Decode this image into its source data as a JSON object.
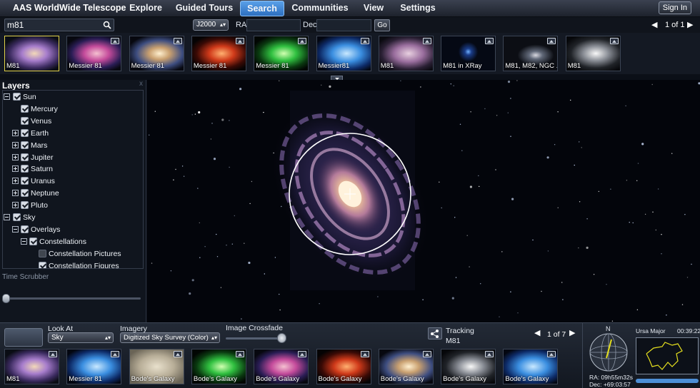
{
  "app": {
    "title": "AAS WorldWide Telescope",
    "sign_in": "Sign In"
  },
  "menu": {
    "items": [
      "Explore",
      "Guided Tours",
      "Search",
      "Communities",
      "View",
      "Settings"
    ],
    "active": "Search"
  },
  "search": {
    "query": "m81",
    "epoch": "J2000",
    "ra_label": "RA",
    "dec_label": "Dec",
    "go_label": "Go",
    "page": "1 of 1"
  },
  "results": [
    {
      "caption": "M81",
      "selected": true
    },
    {
      "caption": "Messier 81"
    },
    {
      "caption": "Messier 81"
    },
    {
      "caption": "Messier 81"
    },
    {
      "caption": "Messier 81"
    },
    {
      "caption": "Messier81"
    },
    {
      "caption": "M81"
    },
    {
      "caption": "M81 in XRay"
    },
    {
      "caption": "M81, M82, NGC ..."
    },
    {
      "caption": "M81"
    }
  ],
  "layers": {
    "title": "Layers",
    "close": "x",
    "tree": [
      {
        "label": "Sun",
        "expander": "minus",
        "checked": true,
        "indent": 0
      },
      {
        "label": "Mercury",
        "expander": "none",
        "checked": true,
        "indent": 1
      },
      {
        "label": "Venus",
        "expander": "none",
        "checked": true,
        "indent": 1
      },
      {
        "label": "Earth",
        "expander": "plus",
        "checked": true,
        "indent": 1
      },
      {
        "label": "Mars",
        "expander": "plus",
        "checked": true,
        "indent": 1
      },
      {
        "label": "Jupiter",
        "expander": "plus",
        "checked": true,
        "indent": 1
      },
      {
        "label": "Saturn",
        "expander": "plus",
        "checked": true,
        "indent": 1
      },
      {
        "label": "Uranus",
        "expander": "plus",
        "checked": true,
        "indent": 1
      },
      {
        "label": "Neptune",
        "expander": "plus",
        "checked": true,
        "indent": 1
      },
      {
        "label": "Pluto",
        "expander": "plus",
        "checked": true,
        "indent": 1
      },
      {
        "label": "Sky",
        "expander": "minus",
        "checked": true,
        "indent": 0
      },
      {
        "label": "Overlays",
        "expander": "minus",
        "checked": true,
        "indent": 1
      },
      {
        "label": "Constellations",
        "expander": "minus",
        "checked": true,
        "indent": 2
      },
      {
        "label": "Constellation Pictures",
        "expander": "none",
        "checked": false,
        "indent": 3
      },
      {
        "label": "Constellation Figures",
        "expander": "none",
        "checked": true,
        "indent": 3
      }
    ],
    "time_scrubber": "Time Scrubber"
  },
  "bottom": {
    "look_at_label": "Look At",
    "look_at_value": "Sky",
    "imagery_label": "Imagery",
    "imagery_value": "Digitized Sky Survey (Color)",
    "crossfade_label": "Image Crossfade",
    "tracking_label": "Tracking",
    "tracking_value": "M81",
    "page": "1 of 7",
    "compass_n": "N",
    "ra": "RA: 09h55m32s",
    "dec": "Dec: +69:03:57",
    "constellation": "Ursa Major",
    "clock": "00:39:22"
  },
  "context": [
    {
      "caption": "M81"
    },
    {
      "caption": "Messier 81"
    },
    {
      "caption": "Bode's Galaxy"
    },
    {
      "caption": "Bode's Galaxy"
    },
    {
      "caption": "Bode's Galaxy"
    },
    {
      "caption": "Bode's Galaxy"
    },
    {
      "caption": "Bode's Galaxy"
    },
    {
      "caption": "Bode's Galaxy"
    },
    {
      "caption": "Bode's Galaxy"
    }
  ],
  "colors": {
    "accent": "#2d6fc0",
    "selection": "#e2d24a",
    "constellation_line": "#e6e01e"
  }
}
